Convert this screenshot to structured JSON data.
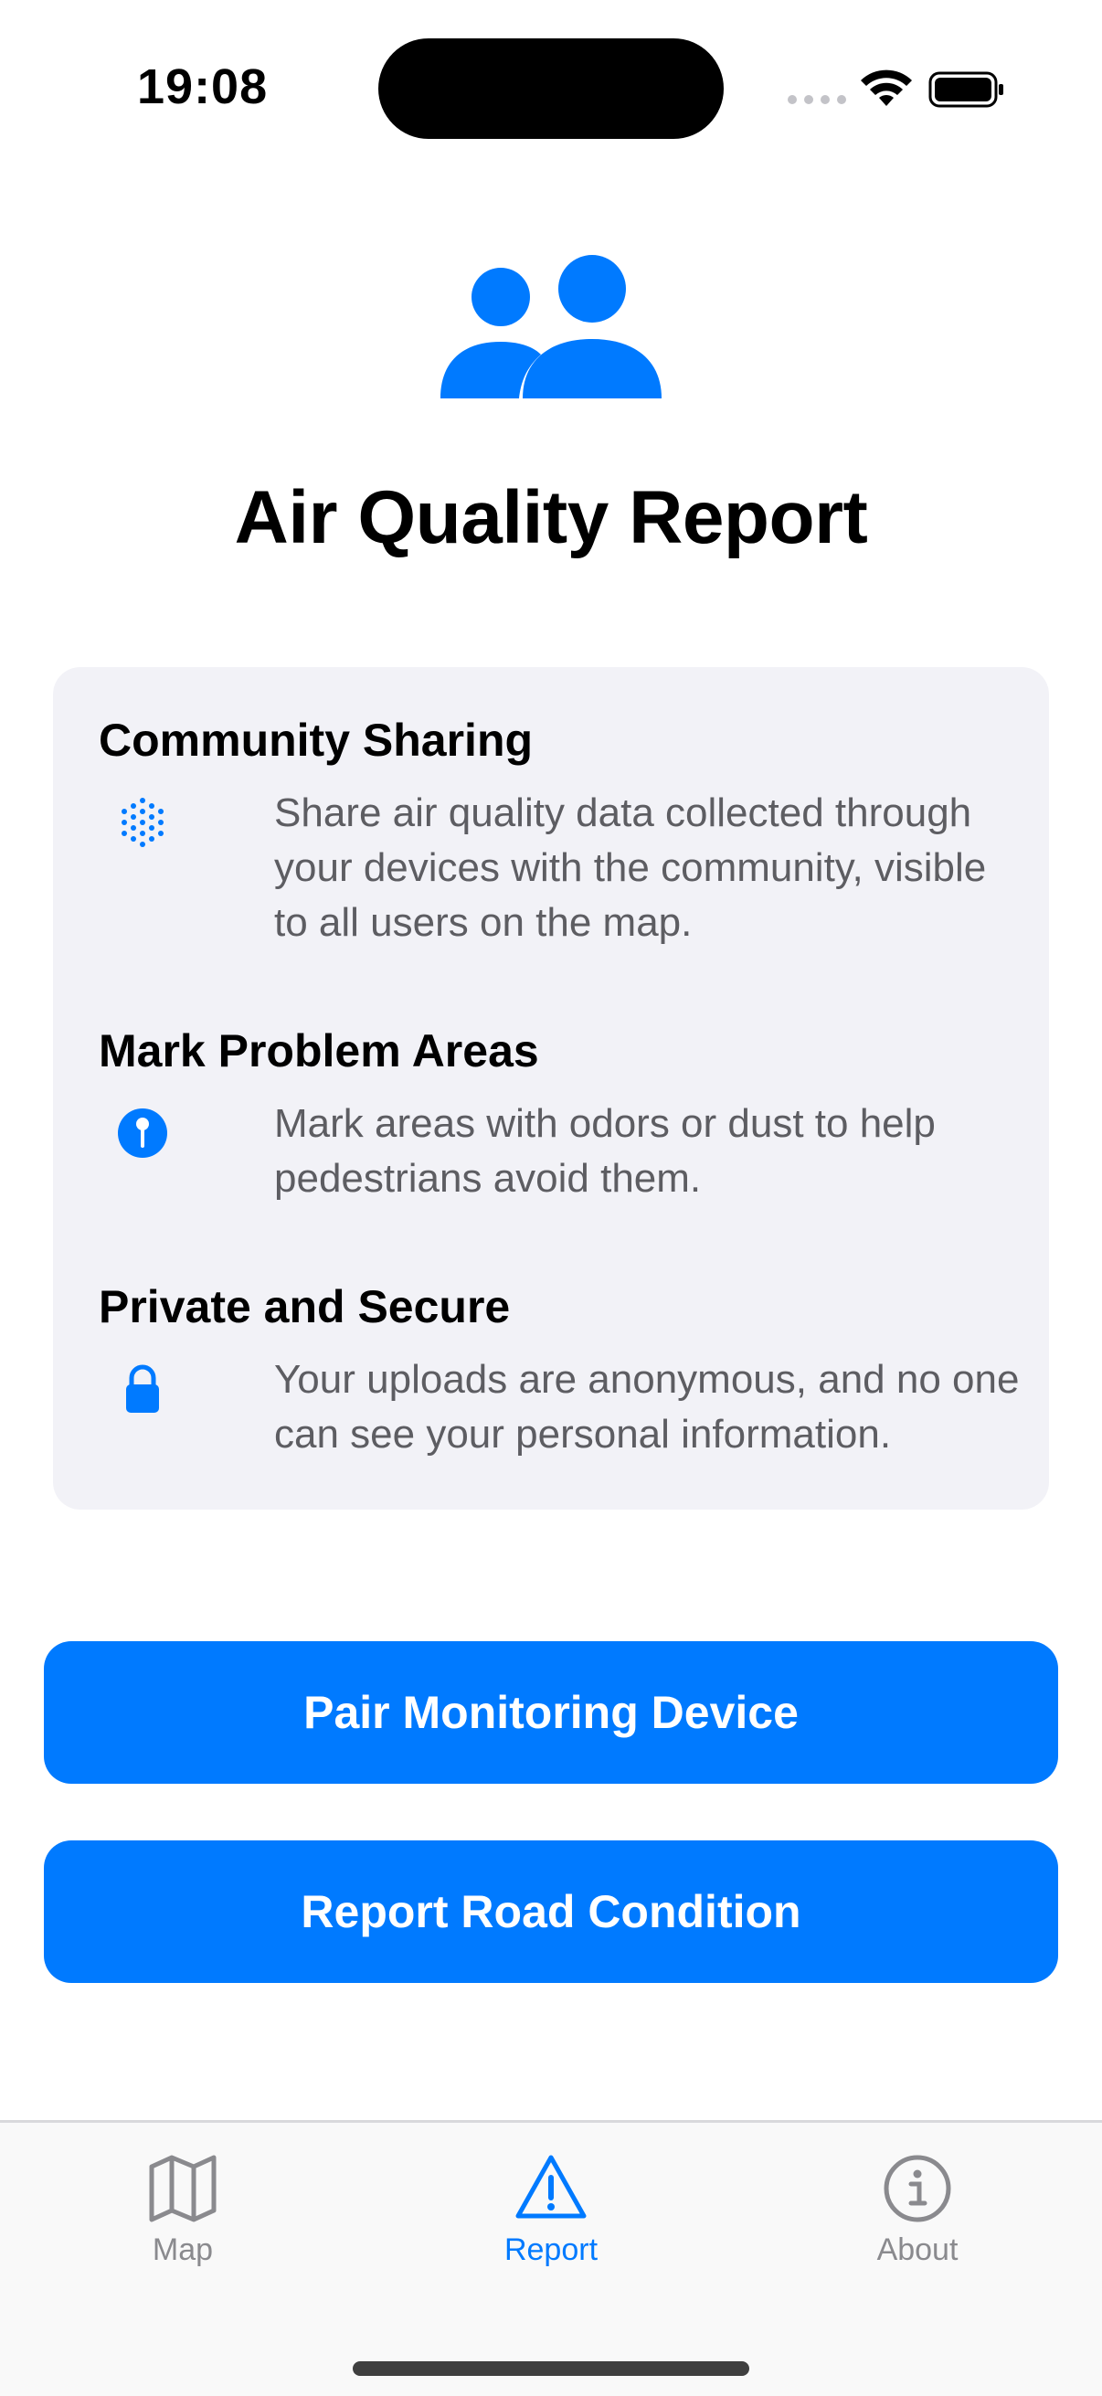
{
  "status_bar": {
    "time": "19:08"
  },
  "page": {
    "title": "Air Quality Report",
    "hero_icon": "two-people-icon"
  },
  "features": [
    {
      "title": "Community Sharing",
      "icon": "dot-grid-icon",
      "description": "Share air quality data collected through your devices with the community, visible to all users on the map."
    },
    {
      "title": "Mark Problem Areas",
      "icon": "map-pin-circle-icon",
      "description": "Mark areas with odors or dust to help pedestrians avoid them."
    },
    {
      "title": "Private and Secure",
      "icon": "lock-icon",
      "description": "Your uploads are anonymous, and no one can see your personal information."
    }
  ],
  "buttons": {
    "pair_device": "Pair Monitoring Device",
    "report_road": "Report Road Condition"
  },
  "tabs": [
    {
      "label": "Map",
      "icon": "map-icon",
      "active": false
    },
    {
      "label": "Report",
      "icon": "warning-triangle-icon",
      "active": true
    },
    {
      "label": "About",
      "icon": "info-circle-icon",
      "active": false
    }
  ],
  "colors": {
    "accent": "#007aff",
    "card_background": "#f2f2f7",
    "secondary_text": "#5d5d62",
    "inactive_tab": "#8a8a8e"
  }
}
